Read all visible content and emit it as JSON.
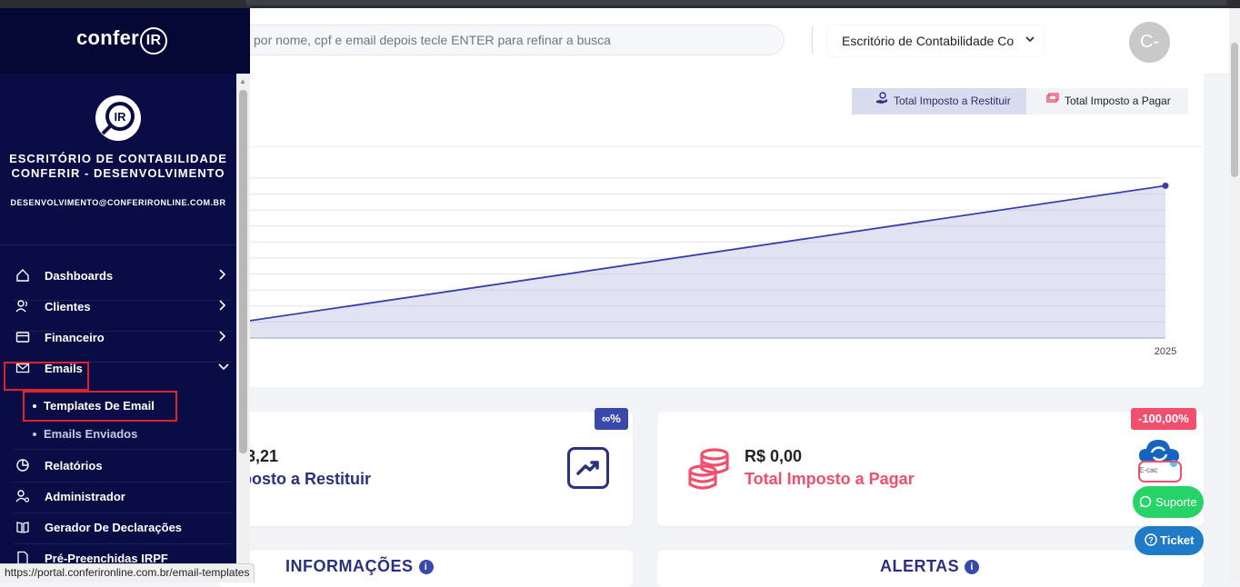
{
  "header": {
    "search_placeholder": "por nome, cpf e email depois tecle ENTER para refinar a busca",
    "office_select": "Escritório de Contabilidade Co",
    "avatar_initials": "C-"
  },
  "chart_section": {
    "toggles": [
      {
        "label": "Total Imposto a Restituir",
        "active": true
      },
      {
        "label": "Total Imposto a Pagar",
        "active": false
      }
    ]
  },
  "chart_data": {
    "type": "area",
    "x": [
      "2025"
    ],
    "series": [
      {
        "values": [
          null,
          1
        ]
      }
    ],
    "grid": true,
    "color": "#3a3fa8"
  },
  "stats": {
    "restituir": {
      "amount": "3,21",
      "label": "posto a Restituir",
      "badge": "∞%"
    },
    "pagar": {
      "amount": "R$ 0,00",
      "label": "Total Imposto a Pagar",
      "badge": "-100,00%"
    }
  },
  "panels": {
    "informacoes": "INFORMAÇÕES",
    "alertas": "ALERTAS"
  },
  "floating": {
    "suporte": "Suporte",
    "ticket": "Ticket",
    "ecac": "E-cac"
  },
  "sidebar": {
    "logo_text": "conferIR",
    "company_name": "ESCRITÓRIO DE CONTABILIDADE CONFERIR - DESENVOLVIMENTO",
    "company_email": "DESENVOLVIMENTO@CONFERIRONLINE.COM.BR",
    "items": [
      {
        "label": "Dashboards",
        "icon": "home-icon"
      },
      {
        "label": "Clientes",
        "icon": "users-icon"
      },
      {
        "label": "Financeiro",
        "icon": "card-icon"
      },
      {
        "label": "Emails",
        "icon": "envelope-icon"
      },
      {
        "label": "Relatórios",
        "icon": "pie-chart-icon"
      },
      {
        "label": "Administrador",
        "icon": "user-gear-icon"
      },
      {
        "label": "Gerador De Declarações",
        "icon": "book-icon"
      },
      {
        "label": "Pré-Preenchidas IRPF",
        "icon": "document-icon"
      }
    ],
    "email_sub": [
      "Templates De Email",
      "Emails Enviados"
    ]
  },
  "status_url": "https://portal.conferironline.com.br/email-templates",
  "colors": {
    "sidebar_bg": "#0a0d45",
    "accent_blue": "#2a3180",
    "accent_red": "#f0506e",
    "highlight": "#e0232b"
  }
}
